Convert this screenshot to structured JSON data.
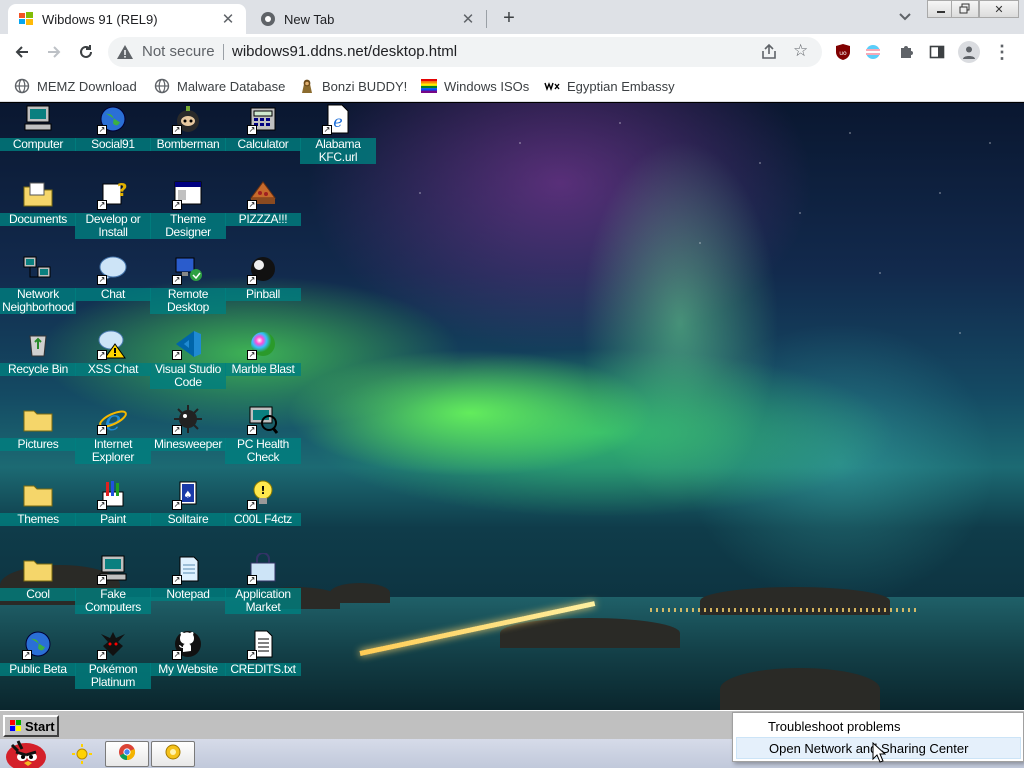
{
  "browser": {
    "tabs": [
      {
        "title": "Wibdows 91 (REL9)",
        "active": true,
        "icon": "windows-flag-icon"
      },
      {
        "title": "New Tab",
        "active": false,
        "icon": "chrome-icon"
      }
    ],
    "omnibox": {
      "security": "Not secure",
      "url": "wibdows91.ddns.net/desktop.html"
    },
    "bookmarks": [
      {
        "label": "MEMZ Download",
        "icon": "globe-icon"
      },
      {
        "label": "Malware Database",
        "icon": "globe-icon"
      },
      {
        "label": "Bonzi BUDDY!",
        "icon": "bonzi-icon"
      },
      {
        "label": "Windows ISOs",
        "icon": "rainbow-flag-icon"
      },
      {
        "label": "Egyptian Embassy",
        "icon": "wix-icon"
      }
    ],
    "colors": {
      "tabstrip": "#dee1e6",
      "omnibox": "#f1f3f4",
      "ublock": "#800000"
    }
  },
  "desktop": {
    "icons": [
      {
        "label": "Computer",
        "type": "computer"
      },
      {
        "label": "Social91",
        "type": "globe"
      },
      {
        "label": "Bomberman",
        "type": "bomberman"
      },
      {
        "label": "Calculator",
        "type": "calculator"
      },
      {
        "label": "Alabama KFC.url",
        "type": "ie-page"
      },
      {
        "label": "Documents",
        "type": "folder-docs"
      },
      {
        "label": "Develop or Install",
        "type": "help"
      },
      {
        "label": "Theme Designer",
        "type": "window"
      },
      {
        "label": "PIZZZA!!!",
        "type": "pizza"
      },
      {
        "label": "Network Neighborhood",
        "type": "network"
      },
      {
        "label": "Chat",
        "type": "chat"
      },
      {
        "label": "Remote Desktop",
        "type": "remote"
      },
      {
        "label": "Pinball",
        "type": "pinball"
      },
      {
        "label": "Recycle Bin",
        "type": "recycle"
      },
      {
        "label": "XSS Chat",
        "type": "xss"
      },
      {
        "label": "Visual Studio Code",
        "type": "vscode"
      },
      {
        "label": "Marble Blast",
        "type": "marble"
      },
      {
        "label": "Pictures",
        "type": "folder"
      },
      {
        "label": "Internet Explorer",
        "type": "ie"
      },
      {
        "label": "Minesweeper",
        "type": "mine"
      },
      {
        "label": "PC Health Check",
        "type": "health"
      },
      {
        "label": "Themes",
        "type": "folder"
      },
      {
        "label": "Paint",
        "type": "paint"
      },
      {
        "label": "Solitaire",
        "type": "solitaire"
      },
      {
        "label": "C00L F4ctz",
        "type": "bulb"
      },
      {
        "label": "Cool",
        "type": "folder"
      },
      {
        "label": "Fake Computers",
        "type": "computer"
      },
      {
        "label": "Notepad",
        "type": "notepad"
      },
      {
        "label": "Application Market",
        "type": "market"
      },
      {
        "label": "Public Beta",
        "type": "globe"
      },
      {
        "label": "Pokémon Platinum",
        "type": "pokemon"
      },
      {
        "label": "My Website",
        "type": "github"
      },
      {
        "label": "CREDITS.txt",
        "type": "txt"
      }
    ]
  },
  "taskbar": {
    "start_label": "Start",
    "context_menu": [
      {
        "label": "Troubleshoot problems",
        "highlighted": false
      },
      {
        "label": "Open Network and Sharing Center",
        "highlighted": true
      }
    ]
  }
}
